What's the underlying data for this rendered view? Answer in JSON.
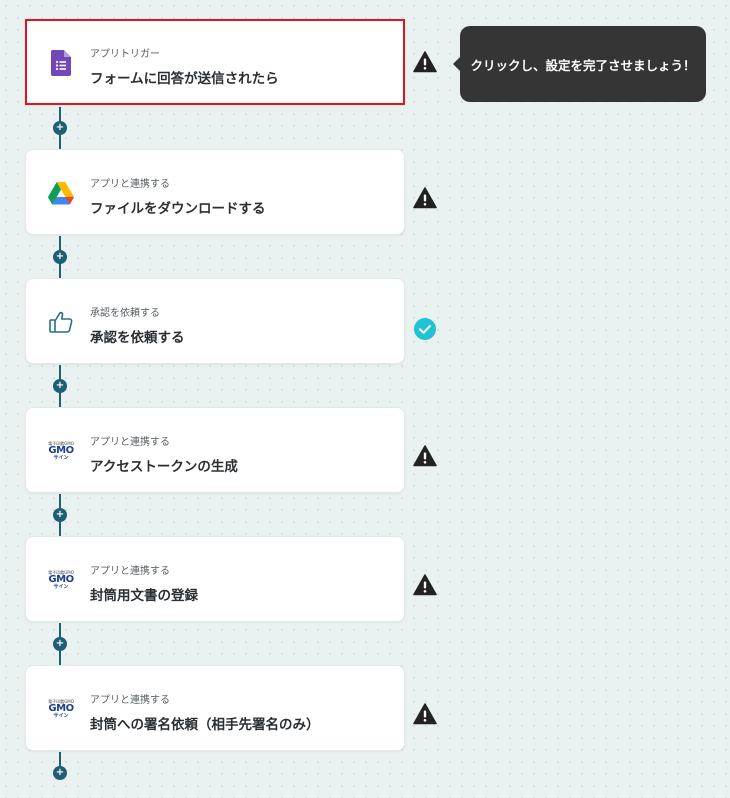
{
  "steps": [
    {
      "subtitle": "アプリトリガー",
      "title": "フォームに回答が送信されたら",
      "icon": "google-forms-icon",
      "status": "warning-icon",
      "selected": true
    },
    {
      "subtitle": "アプリと連携する",
      "title": "ファイルをダウンロードする",
      "icon": "google-drive-icon",
      "status": "warning-icon",
      "selected": false
    },
    {
      "subtitle": "承認を依頼する",
      "title": "承認を依頼する",
      "icon": "thumbs-up-icon",
      "status": "check-icon",
      "selected": false
    },
    {
      "subtitle": "アプリと連携する",
      "title": "アクセストークンの生成",
      "icon": "gmo-sign-logo",
      "status": "warning-icon",
      "selected": false
    },
    {
      "subtitle": "アプリと連携する",
      "title": "封筒用文書の登録",
      "icon": "gmo-sign-logo",
      "status": "warning-icon",
      "selected": false
    },
    {
      "subtitle": "アプリと連携する",
      "title": "封筒への署名依頼（相手先署名のみ）",
      "icon": "gmo-sign-logo",
      "status": "warning-icon",
      "selected": false
    }
  ],
  "gmo_logo": {
    "top": "電子印鑑GMO",
    "main": "GMO",
    "bottom": "サイン"
  },
  "tooltip": {
    "text": "クリックし、設定を完了させましょう！"
  },
  "add_symbol": "+",
  "colors": {
    "selected_border": "#e0141e",
    "connector": "#1f5f73",
    "warning": "#222222",
    "check": "#22c1d6",
    "tooltip_bg": "#353535"
  }
}
